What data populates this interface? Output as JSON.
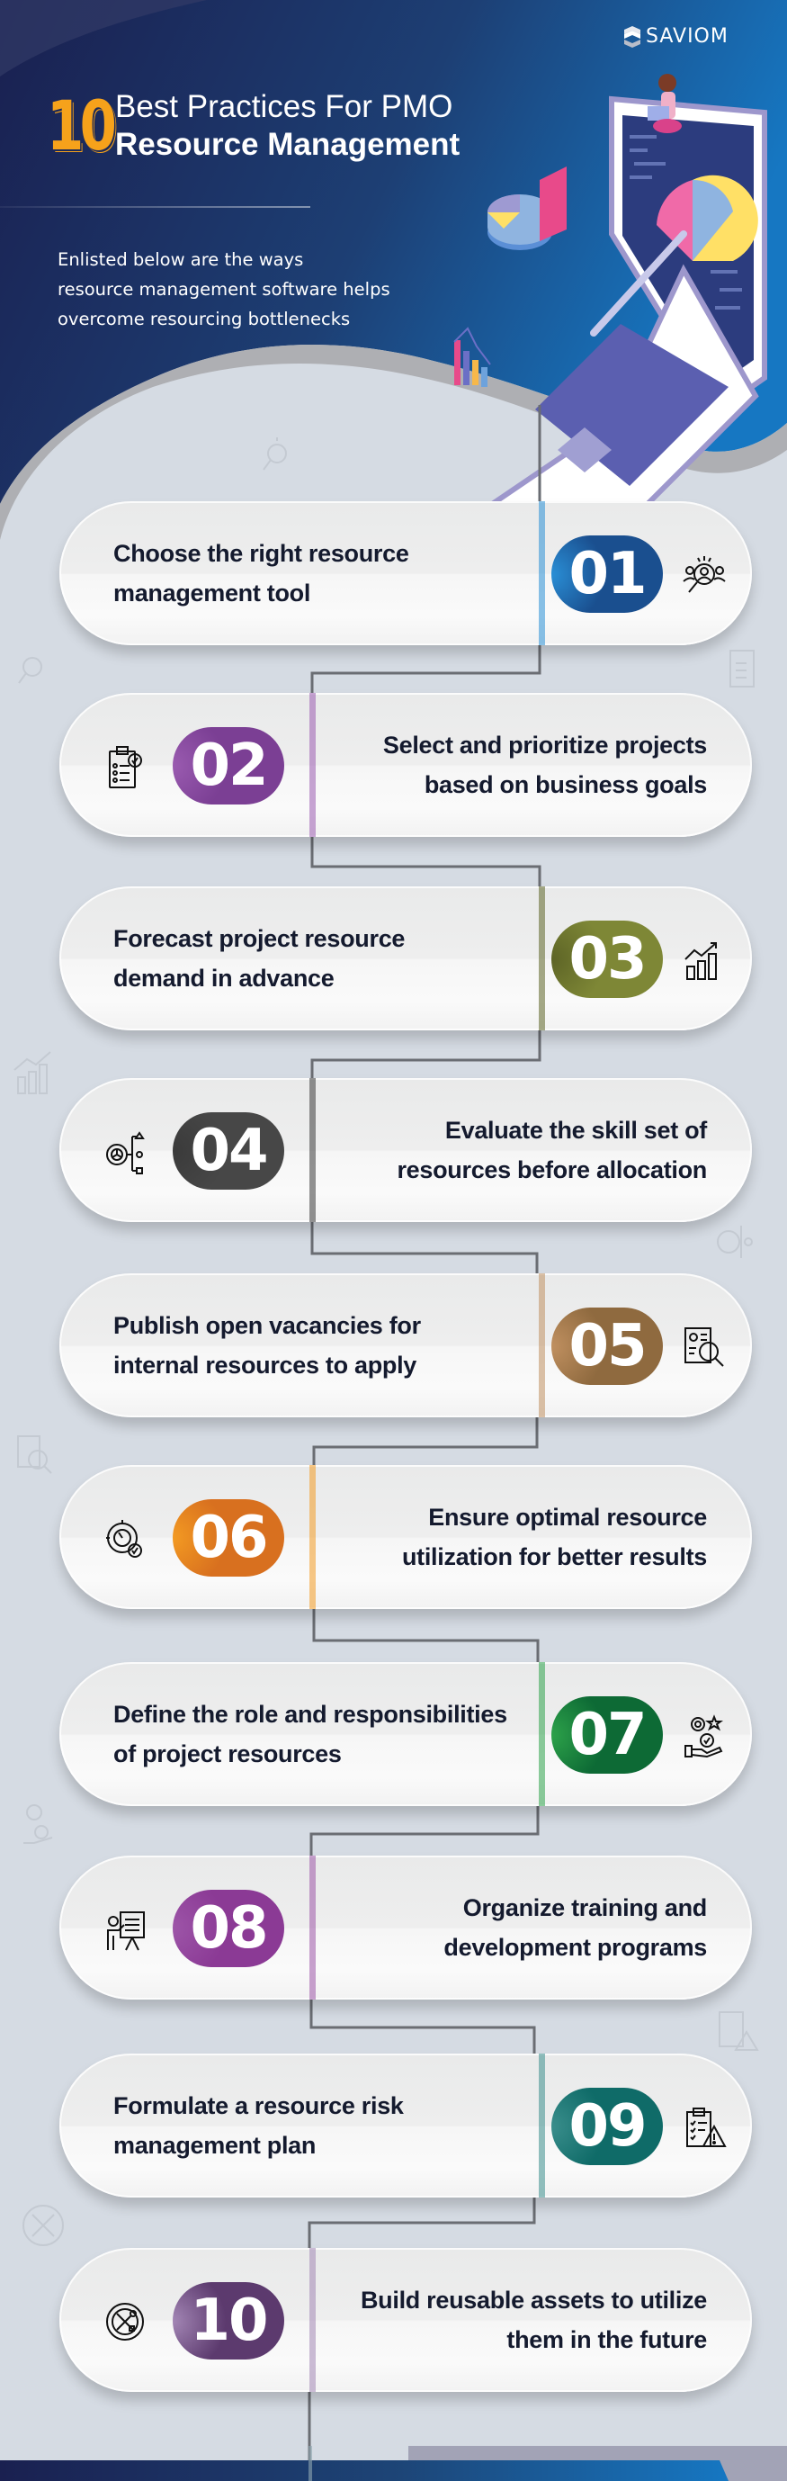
{
  "brand": {
    "logo_text": "SAVIOM"
  },
  "header": {
    "number": "10",
    "title_line1": "Best Practices For PMO",
    "title_line2": "Resource Management",
    "intro_lines": [
      "Enlisted below are the ways",
      "resource management software helps",
      "overcome resourcing bottlenecks"
    ]
  },
  "colors": {
    "hero_dark": "#1b2352",
    "hero_blue": "#1a72b8",
    "accent_orange": "#f6a21b",
    "page_bg": "#d5dbe3",
    "card_text": "#141a2e"
  },
  "practices": [
    {
      "number": "01",
      "lines": [
        "Choose the right resource",
        "management tool"
      ],
      "icon": "search-people-icon",
      "color": "#1a4f8f",
      "color2": "#2a8fd6",
      "side": "left"
    },
    {
      "number": "02",
      "lines": [
        "Select and prioritize projects",
        "based on business goals"
      ],
      "icon": "checklist-icon",
      "color": "#7b3f94",
      "color2": "#9a5bb0",
      "side": "right"
    },
    {
      "number": "03",
      "lines": [
        "Forecast project resource",
        "demand in advance"
      ],
      "icon": "growth-chart-icon",
      "color": "#7e8736",
      "color2": "#5d6426",
      "side": "left"
    },
    {
      "number": "04",
      "lines": [
        "Evaluate the skill set of",
        "resources before allocation"
      ],
      "icon": "gear-hierarchy-icon",
      "color": "#474747",
      "color2": "#3a3a3a",
      "side": "right"
    },
    {
      "number": "05",
      "lines": [
        "Publish open vacancies for",
        "internal resources to apply"
      ],
      "icon": "resume-search-icon",
      "color": "#8f6a3f",
      "color2": "#c09060",
      "side": "left"
    },
    {
      "number": "06",
      "lines": [
        "Ensure optimal resource",
        "utilization for better results"
      ],
      "icon": "gear-gauge-icon",
      "color": "#d8701f",
      "color2": "#f39a22",
      "side": "right"
    },
    {
      "number": "07",
      "lines": [
        "Define the role and responsibilities",
        "of project resources"
      ],
      "icon": "gear-hand-icon",
      "color": "#0d6a35",
      "color2": "#2da24a",
      "side": "left"
    },
    {
      "number": "08",
      "lines": [
        "Organize training and",
        "development programs"
      ],
      "icon": "presentation-icon",
      "color": "#8b3a95",
      "color2": "#9d55a8",
      "side": "right"
    },
    {
      "number": "09",
      "lines": [
        "Formulate a resource risk",
        "management plan"
      ],
      "icon": "risk-clipboard-icon",
      "color": "#0f6b68",
      "color2": "#3a8e8c",
      "side": "left"
    },
    {
      "number": "10",
      "lines": [
        "Build reusable assets to utilize",
        "them in the future"
      ],
      "icon": "gear-tools-icon",
      "color": "#5c3a6e",
      "color2": "#a386b5",
      "side": "right"
    }
  ]
}
